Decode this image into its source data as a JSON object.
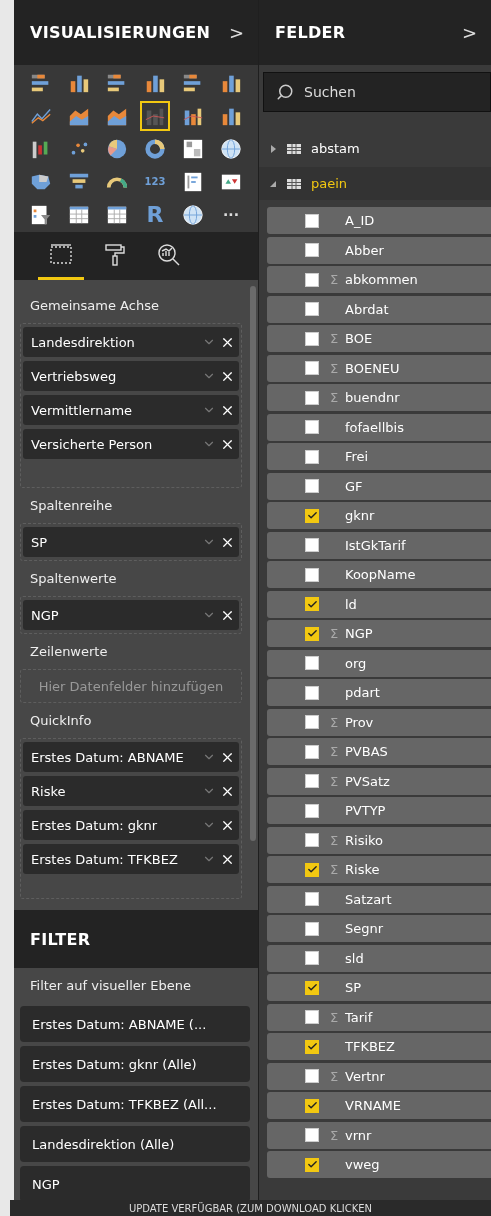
{
  "visualizations": {
    "title": "VISUALISIERUNGEN",
    "collapse": ">",
    "visuals": [
      {
        "kind": "hbar",
        "selected": false
      },
      {
        "kind": "col",
        "selected": false
      },
      {
        "kind": "hbar",
        "selected": false
      },
      {
        "kind": "col",
        "selected": false
      },
      {
        "kind": "hbar",
        "selected": false
      },
      {
        "kind": "col",
        "selected": false
      },
      {
        "kind": "line",
        "selected": false
      },
      {
        "kind": "area",
        "selected": false
      },
      {
        "kind": "area",
        "selected": false
      },
      {
        "kind": "combo",
        "selected": true
      },
      {
        "kind": "combo",
        "selected": false
      },
      {
        "kind": "col",
        "selected": false
      },
      {
        "kind": "waterfall",
        "selected": false
      },
      {
        "kind": "scatter",
        "selected": false
      },
      {
        "kind": "pie",
        "selected": false
      },
      {
        "kind": "donut",
        "selected": false
      },
      {
        "kind": "treemap",
        "selected": false
      },
      {
        "kind": "globe",
        "selected": false
      },
      {
        "kind": "map",
        "selected": false
      },
      {
        "kind": "funnel",
        "selected": false
      },
      {
        "kind": "gauge",
        "selected": false
      },
      {
        "kind": "card",
        "label": "123",
        "selected": false
      },
      {
        "kind": "list",
        "selected": false
      },
      {
        "kind": "kpi",
        "selected": false
      },
      {
        "kind": "slicer",
        "selected": false
      },
      {
        "kind": "table",
        "selected": false
      },
      {
        "kind": "table",
        "selected": false
      },
      {
        "kind": "letter",
        "label": "R",
        "selected": false
      },
      {
        "kind": "globe",
        "selected": false
      },
      {
        "kind": "more",
        "label": "···",
        "selected": false
      }
    ],
    "tabs": [
      {
        "kind": "fields",
        "selected": true
      },
      {
        "kind": "format",
        "selected": false
      },
      {
        "kind": "analytics",
        "selected": false
      }
    ],
    "wells": [
      {
        "label": "Gemeinsame Achse",
        "items": [
          "Landesdirektion",
          "Vertriebsweg",
          "Vermittlername",
          "Versicherte Person"
        ]
      },
      {
        "label": "Spaltenreihe",
        "items": [
          "SP"
        ]
      },
      {
        "label": "Spaltenwerte",
        "items": [
          "NGP"
        ]
      },
      {
        "label": "Zeilenwerte",
        "placeholder": "Hier Datenfelder hinzufügen"
      },
      {
        "label": "QuickInfo",
        "items": [
          "Erstes Datum: ABNAME",
          "Riske",
          "Erstes Datum: gknr",
          "Erstes Datum: TFKBEZ"
        ]
      }
    ]
  },
  "filter": {
    "title": "FILTER",
    "subtitle": "Filter auf visueller Ebene",
    "items": [
      "Erstes Datum: ABNAME (...",
      "Erstes Datum: gknr (Alle)",
      "Erstes Datum: TFKBEZ (All...",
      "Landesdirektion (Alle)",
      "NGP"
    ]
  },
  "fields": {
    "title": "FELDER",
    "collapse": ">",
    "search": {
      "placeholder": "Suchen"
    },
    "tables": [
      {
        "name": "abstam",
        "expanded": false
      },
      {
        "name": "paein",
        "expanded": true,
        "children": [
          {
            "name": "A_ID",
            "checked": false
          },
          {
            "name": "Abber",
            "checked": false
          },
          {
            "name": "abkommen",
            "prefix": "Σ",
            "checked": false
          },
          {
            "name": "Abrdat",
            "checked": false
          },
          {
            "name": "BOE",
            "prefix": "Σ",
            "checked": false
          },
          {
            "name": "BOENEU",
            "prefix": "Σ",
            "checked": false
          },
          {
            "name": "buendnr",
            "prefix": "Σ",
            "checked": false
          },
          {
            "name": "fofaellbis",
            "checked": false
          },
          {
            "name": "Frei",
            "checked": false
          },
          {
            "name": "GF",
            "checked": false
          },
          {
            "name": "gknr",
            "checked": true
          },
          {
            "name": "IstGkTarif",
            "checked": false
          },
          {
            "name": "KoopName",
            "checked": false
          },
          {
            "name": "ld",
            "checked": true
          },
          {
            "name": "NGP",
            "prefix": "Σ",
            "checked": true
          },
          {
            "name": "org",
            "checked": false
          },
          {
            "name": "pdart",
            "checked": false
          },
          {
            "name": "Prov",
            "prefix": "Σ",
            "checked": false
          },
          {
            "name": "PVBAS",
            "prefix": "Σ",
            "checked": false
          },
          {
            "name": "PVSatz",
            "prefix": "Σ",
            "checked": false
          },
          {
            "name": "PVTYP",
            "checked": false
          },
          {
            "name": "Risiko",
            "prefix": "Σ",
            "checked": false
          },
          {
            "name": "Riske",
            "prefix": "Σ",
            "checked": true
          },
          {
            "name": "Satzart",
            "checked": false
          },
          {
            "name": "Segnr",
            "checked": false
          },
          {
            "name": "sld",
            "checked": false
          },
          {
            "name": "SP",
            "checked": true
          },
          {
            "name": "Tarif",
            "prefix": "Σ",
            "checked": false
          },
          {
            "name": "TFKBEZ",
            "checked": true
          },
          {
            "name": "Vertnr",
            "prefix": "Σ",
            "checked": false
          },
          {
            "name": "VRNAME",
            "checked": true
          },
          {
            "name": "vrnr",
            "prefix": "Σ",
            "checked": false
          },
          {
            "name": "vweg",
            "checked": true
          }
        ]
      }
    ]
  },
  "status_bar": {
    "text": "UPDATE VERFÜGBAR (ZUM DOWNLOAD KLICKEN"
  }
}
